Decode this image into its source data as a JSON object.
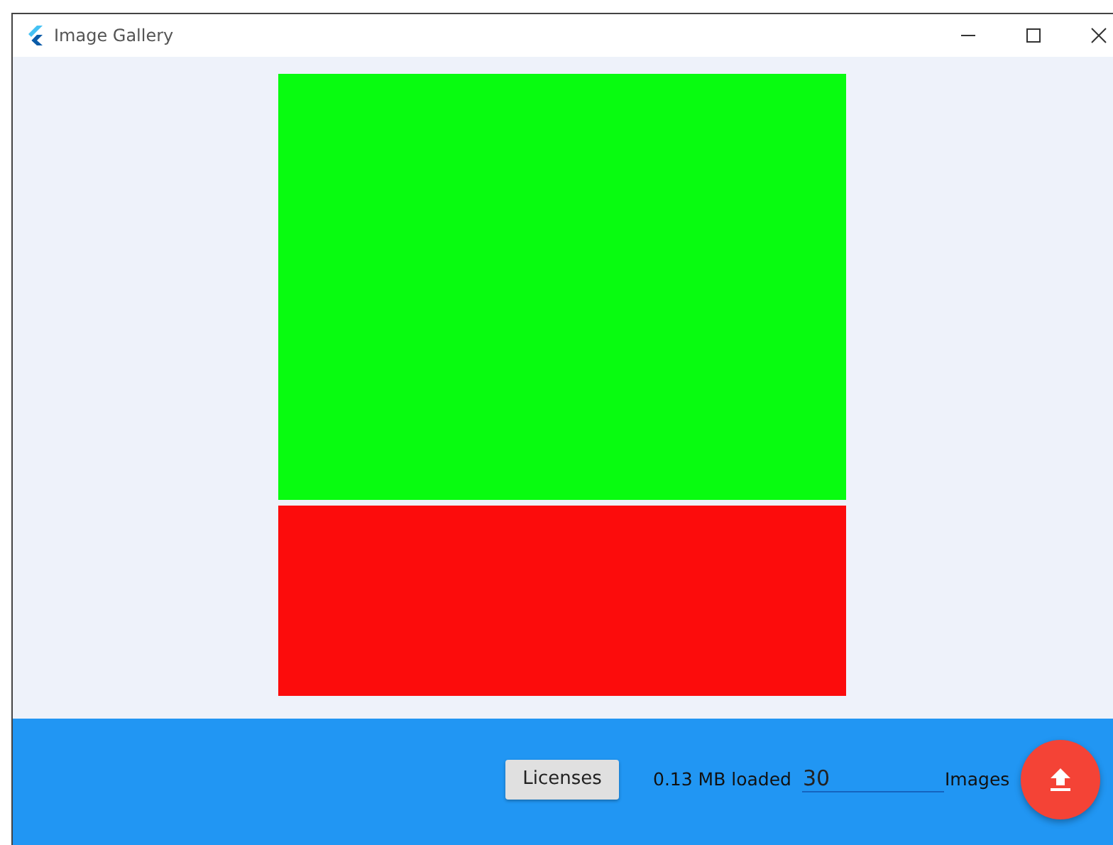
{
  "window": {
    "title": "Image Gallery"
  },
  "images": [
    {
      "color": "#08fc10"
    },
    {
      "color": "#fc0c0c"
    }
  ],
  "bottom_bar": {
    "licenses_button": "Licenses",
    "loaded": "0.13 MB loaded",
    "image_count": "30",
    "images_label": "Images"
  }
}
